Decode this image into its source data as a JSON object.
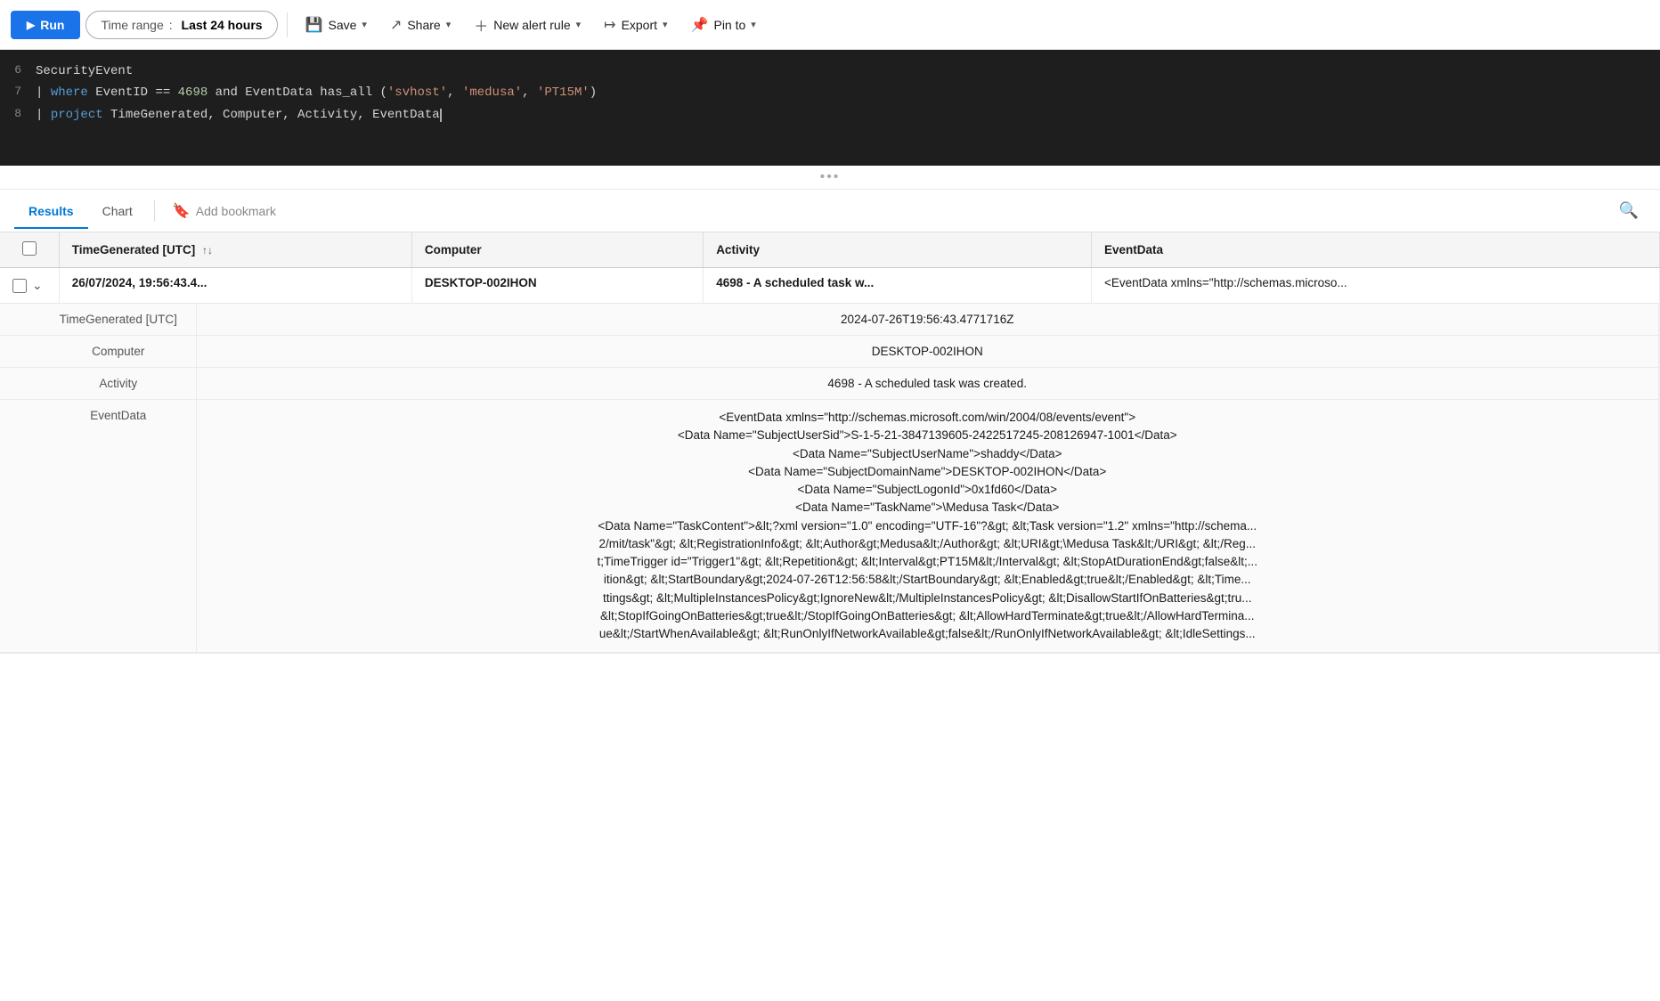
{
  "toolbar": {
    "run_label": "Run",
    "time_range_label": "Time range",
    "time_range_value": "Last 24 hours",
    "save_label": "Save",
    "share_label": "Share",
    "new_alert_label": "New alert rule",
    "export_label": "Export",
    "pin_label": "Pin to"
  },
  "editor": {
    "lines": [
      {
        "num": "6",
        "content": "SecurityEvent"
      },
      {
        "num": "7",
        "content": "| where EventID == 4698 and EventData has_all ('svhost', 'medusa', 'PT15M')"
      },
      {
        "num": "8",
        "content": "| project TimeGenerated, Computer, Activity, EventData"
      }
    ]
  },
  "tabs": {
    "results_label": "Results",
    "chart_label": "Chart",
    "bookmark_label": "Add bookmark"
  },
  "table": {
    "columns": [
      "TimeGenerated [UTC]",
      "Computer",
      "Activity",
      "EventData"
    ],
    "rows": [
      {
        "expanded": true,
        "time": "26/07/2024, 19:56:43.4...",
        "computer": "DESKTOP-002IHON",
        "activity": "4698 - A scheduled task w...",
        "eventdata": "<EventData xmlns=\"http://schemas.microso...",
        "detail": {
          "fields": [
            {
              "name": "TimeGenerated [UTC]",
              "value": "2024-07-26T19:56:43.4771716Z"
            },
            {
              "name": "Computer",
              "value": "DESKTOP-002IHON"
            },
            {
              "name": "Activity",
              "value": "4698 - A scheduled task was created."
            }
          ],
          "eventdata_label": "EventData",
          "eventdata_value": "<EventData xmlns=\"http://schemas.microsoft.com/win/2004/08/events/event\">\n<Data Name=\"SubjectUserSid\">S-1-5-21-3847139605-2422517245-208126947-1001</Data>\n<Data Name=\"SubjectUserName\">shaddy</Data>\n<Data Name=\"SubjectDomainName\">DESKTOP-002IHON</Data>\n<Data Name=\"SubjectLogonId\">0x1fd60</Data>\n<Data Name=\"TaskName\">\\Medusa Task</Data>\n<Data Name=\"TaskContent\">&lt;?xml version=\"1.0\" encoding=\"UTF-16\"?&gt; &lt;Task version=\"1.2\" xmlns=\"http://schema...\n2/mit/task\"&gt; &lt;RegistrationInfo&gt; &lt;Author&gt;Medusa&lt;/Author&gt; &lt;URI&gt;\\Medusa Task&lt;/URI&gt; &lt;/Reg...\nt;TimeTrigger id=\"Trigger1\"&gt; &lt;Repetition&gt; &lt;Interval&gt;PT15M&lt;/Interval&gt; &lt;StopAtDurationEnd&gt;false&lt;...\nition&gt; &lt;StartBoundary&gt;2024-07-26T12:56:58&lt;/StartBoundary&gt; &lt;Enabled&gt;true&lt;/Enabled&gt; &lt;Time...\nttings&gt; &lt;MultipleInstancesPolicy&gt;IgnoreNew&lt;/MultipleInstancesPolicy&gt; &lt;DisallowStartIfOnBatteries&gt;tru...\n&lt;StopIfGoingOnBatteries&gt;true&lt;/StopIfGoingOnBatteries&gt; &lt;AllowHardTerminate&gt;true&lt;/AllowHardTermina...\nue&lt;/StartWhenAvailable&gt; &lt;RunOnlyIfNetworkAvailable&gt;false&lt;/RunOnlyIfNetworkAvailable&gt; &lt;IdleSettings..."
        }
      }
    ]
  }
}
